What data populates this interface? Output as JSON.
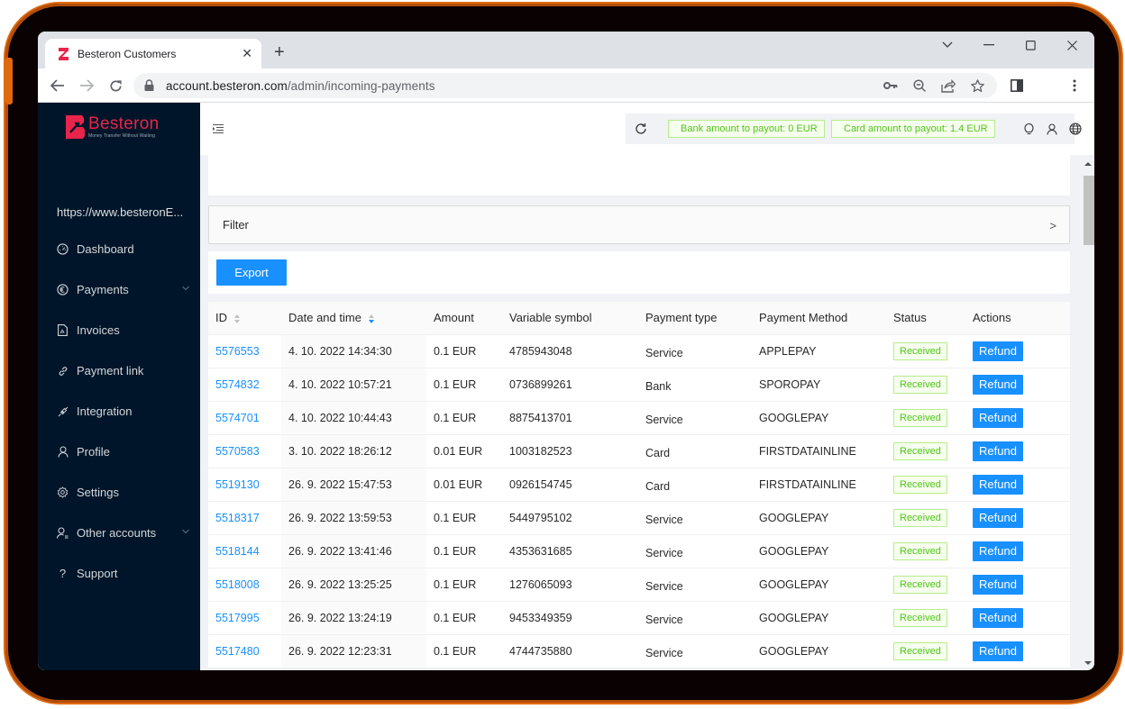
{
  "browser": {
    "tab_title": "Besteron Customers",
    "url_host": "account.besteron.com",
    "url_path": "/admin/incoming-payments"
  },
  "sidebar": {
    "logo_name": "Besteron",
    "logo_tagline": "Money Transfer Without Waiting",
    "merchant": "https://www.besteronE...",
    "items": [
      {
        "label": "Dashboard",
        "icon": "dashboard-icon",
        "expandable": false
      },
      {
        "label": "Payments",
        "icon": "euro-circle-icon",
        "expandable": true
      },
      {
        "label": "Invoices",
        "icon": "pdf-file-icon",
        "expandable": false
      },
      {
        "label": "Payment link",
        "icon": "link-icon",
        "expandable": false
      },
      {
        "label": "Integration",
        "icon": "plug-icon",
        "expandable": false
      },
      {
        "label": "Profile",
        "icon": "user-icon",
        "expandable": false
      },
      {
        "label": "Settings",
        "icon": "gear-icon",
        "expandable": false
      },
      {
        "label": "Other accounts",
        "icon": "user-switch-icon",
        "expandable": true
      },
      {
        "label": "Support",
        "icon": "question-icon",
        "expandable": false
      }
    ]
  },
  "header": {
    "bank_payout": "Bank amount to payout: 0 EUR",
    "card_payout": "Card amount to payout: 1.4 EUR"
  },
  "filter": {
    "label": "Filter"
  },
  "toolbar": {
    "export_label": "Export"
  },
  "colors": {
    "primary": "#1890ff",
    "success": "#52c41a",
    "sidebar": "#001529",
    "brand": "#e8244a"
  },
  "table": {
    "columns": [
      "ID",
      "Date and time",
      "Amount",
      "Variable symbol",
      "Payment type",
      "Payment Method",
      "Status",
      "Actions"
    ],
    "sorted_column": "Date and time",
    "sort_order": "descending",
    "action_label": "Refund",
    "rows": [
      {
        "id": "5576553",
        "date": "4. 10. 2022 14:34:30",
        "amount": "0.1 EUR",
        "vs": "4785943048",
        "type": "Service",
        "method": "APPLEPAY",
        "status": "Received"
      },
      {
        "id": "5574832",
        "date": "4. 10. 2022 10:57:21",
        "amount": "0.1 EUR",
        "vs": "0736899261",
        "type": "Bank",
        "method": "SPOROPAY",
        "status": "Received"
      },
      {
        "id": "5574701",
        "date": "4. 10. 2022 10:44:43",
        "amount": "0.1 EUR",
        "vs": "8875413701",
        "type": "Service",
        "method": "GOOGLEPAY",
        "status": "Received"
      },
      {
        "id": "5570583",
        "date": "3. 10. 2022 18:26:12",
        "amount": "0.01 EUR",
        "vs": "1003182523",
        "type": "Card",
        "method": "FIRSTDATAINLINE",
        "status": "Received"
      },
      {
        "id": "5519130",
        "date": "26. 9. 2022 15:47:53",
        "amount": "0.01 EUR",
        "vs": "0926154745",
        "type": "Card",
        "method": "FIRSTDATAINLINE",
        "status": "Received"
      },
      {
        "id": "5518317",
        "date": "26. 9. 2022 13:59:53",
        "amount": "0.1 EUR",
        "vs": "5449795102",
        "type": "Service",
        "method": "GOOGLEPAY",
        "status": "Received"
      },
      {
        "id": "5518144",
        "date": "26. 9. 2022 13:41:46",
        "amount": "0.1 EUR",
        "vs": "4353631685",
        "type": "Service",
        "method": "GOOGLEPAY",
        "status": "Received"
      },
      {
        "id": "5518008",
        "date": "26. 9. 2022 13:25:25",
        "amount": "0.1 EUR",
        "vs": "1276065093",
        "type": "Service",
        "method": "GOOGLEPAY",
        "status": "Received"
      },
      {
        "id": "5517995",
        "date": "26. 9. 2022 13:24:19",
        "amount": "0.1 EUR",
        "vs": "9453349359",
        "type": "Service",
        "method": "GOOGLEPAY",
        "status": "Received"
      },
      {
        "id": "5517480",
        "date": "26. 9. 2022 12:23:31",
        "amount": "0.1 EUR",
        "vs": "4744735880",
        "type": "Service",
        "method": "GOOGLEPAY",
        "status": "Received"
      }
    ]
  }
}
